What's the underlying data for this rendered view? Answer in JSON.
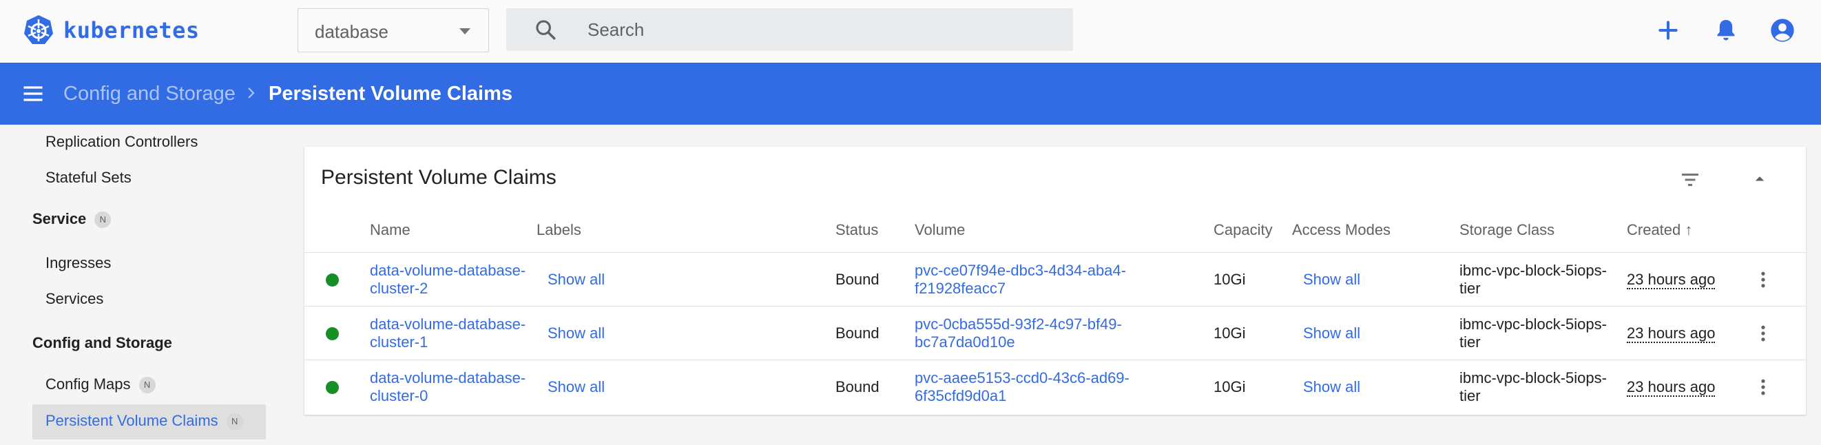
{
  "app": {
    "name": "kubernetes",
    "brand_color": "#326ce5"
  },
  "header": {
    "namespace": "database",
    "search_placeholder": "Search"
  },
  "breadcrumb": {
    "parent": "Config and Storage",
    "current": "Persistent Volume Claims"
  },
  "sidebar": {
    "items": [
      {
        "label": "Replication Controllers"
      },
      {
        "label": "Stateful Sets"
      }
    ],
    "service": {
      "label": "Service",
      "badge": "N",
      "items": [
        "Ingresses",
        "Services"
      ]
    },
    "config": {
      "label": "Config and Storage",
      "items": [
        {
          "label": "Config Maps",
          "badge": "N"
        },
        {
          "label": "Persistent Volume Claims",
          "badge": "N",
          "active": true
        }
      ]
    }
  },
  "card": {
    "title": "Persistent Volume Claims",
    "columns": [
      "Name",
      "Labels",
      "Status",
      "Volume",
      "Capacity",
      "Access Modes",
      "Storage Class",
      "Created"
    ],
    "sort_indicator": "↑",
    "rows": [
      {
        "name_l1": "data-volume-database-",
        "name_l2": "cluster-2",
        "labels": "Show all",
        "status": "Bound",
        "vol_l1": "pvc-ce07f94e-dbc3-4d34-aba4-",
        "vol_l2": "f21928feacc7",
        "capacity": "10Gi",
        "access": "Show all",
        "sc_l1": "ibmc-vpc-block-5iops-",
        "sc_l2": "tier",
        "created": "23 hours ago",
        "status_color": "#168f27"
      },
      {
        "name_l1": "data-volume-database-",
        "name_l2": "cluster-1",
        "labels": "Show all",
        "status": "Bound",
        "vol_l1": "pvc-0cba555d-93f2-4c97-bf49-",
        "vol_l2": "bc7a7da0d10e",
        "capacity": "10Gi",
        "access": "Show all",
        "sc_l1": "ibmc-vpc-block-5iops-",
        "sc_l2": "tier",
        "created": "23 hours ago",
        "status_color": "#168f27"
      },
      {
        "name_l1": "data-volume-database-",
        "name_l2": "cluster-0",
        "labels": "Show all",
        "status": "Bound",
        "vol_l1": "pvc-aaee5153-ccd0-43c6-ad69-",
        "vol_l2": "6f35cfd9d0a1",
        "capacity": "10Gi",
        "access": "Show all",
        "sc_l1": "ibmc-vpc-block-5iops-",
        "sc_l2": "tier",
        "created": "23 hours ago",
        "status_color": "#168f27"
      }
    ]
  },
  "icons": {
    "logo": "kubernetes-logo",
    "dropdown": "chevron-down-icon",
    "search": "search-icon",
    "add": "plus-icon",
    "notifications": "bell-icon",
    "account": "account-circle-icon",
    "menu": "menu-icon",
    "separator": "chevron-right-icon",
    "filter": "filter-icon",
    "collapse": "chevron-up-icon",
    "row_actions": "more-vert-icon"
  }
}
